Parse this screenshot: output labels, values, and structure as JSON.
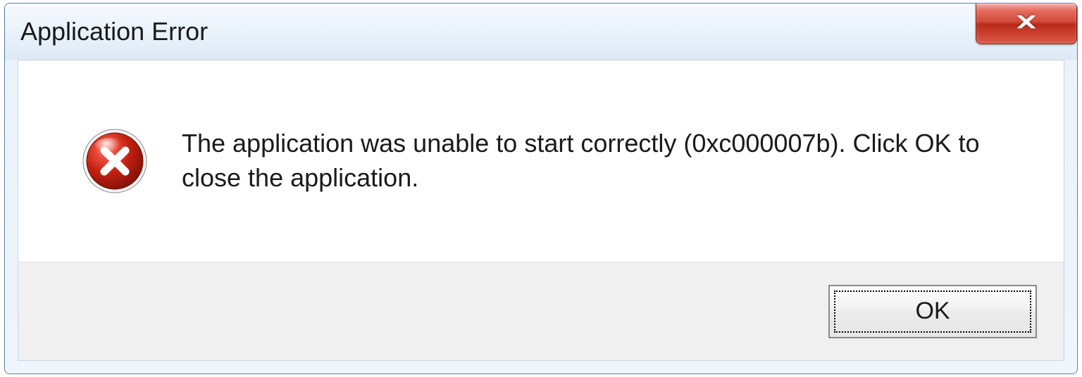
{
  "dialog": {
    "title": "Application Error",
    "message": "The application was unable to start correctly (0xc000007b). Click OK to close the application.",
    "ok_label": "OK",
    "icon": "error-icon"
  }
}
